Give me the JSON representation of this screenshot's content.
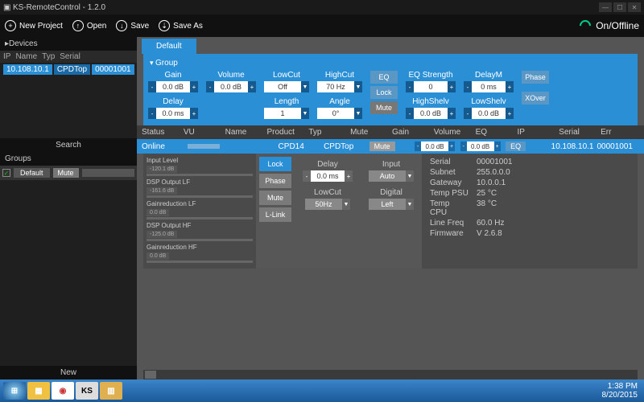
{
  "title": "KS-RemoteControl - 1.2.0",
  "toolbar": {
    "new": "New Project",
    "open": "Open",
    "save": "Save",
    "saveas": "Save As",
    "onoff": "On/Offline"
  },
  "sidebar": {
    "devices_label": "Devices",
    "cols": {
      "ip": "IP",
      "name": "Name",
      "typ": "Typ",
      "serial": "Serial"
    },
    "row": {
      "ip": "10.108.10.1",
      "name": "",
      "typ": "CPDTop",
      "serial": "00001001"
    },
    "search": "Search",
    "groups_label": "Groups",
    "group": {
      "name": "Default",
      "mute": "Mute"
    },
    "new": "New"
  },
  "tab": "Default",
  "group_head": "Group",
  "controls": {
    "gain": {
      "label": "Gain",
      "val": "0.0 dB"
    },
    "volume": {
      "label": "Volume",
      "val": "0.0 dB"
    },
    "delay": {
      "label": "Delay",
      "val": "0.0 ms"
    },
    "lowcut": {
      "label": "LowCut",
      "val": "Off"
    },
    "highcut": {
      "label": "HighCut",
      "val": "70 Hz"
    },
    "length": {
      "label": "Length",
      "val": "1"
    },
    "angle": {
      "label": "Angle",
      "val": "0°"
    },
    "eqstr": {
      "label": "EQ Strength",
      "val": "0"
    },
    "delaym": {
      "label": "DelayM",
      "val": "0 ms"
    },
    "highshelv": {
      "label": "HighShelv",
      "val": "0.0 dB"
    },
    "lowshelv": {
      "label": "LowShelv",
      "val": "0.0 dB"
    },
    "eq": "EQ",
    "lock": "Lock",
    "mute": "Mute",
    "phase": "Phase",
    "xover": "XOver"
  },
  "table": {
    "heads": {
      "status": "Status",
      "vu": "VU",
      "name": "Name",
      "product": "Product",
      "typ": "Typ",
      "mute": "Mute",
      "gain": "Gain",
      "volume": "Volume",
      "eq": "EQ",
      "ip": "IP",
      "serial": "Serial",
      "err": "Err"
    },
    "row": {
      "status": "Online",
      "name": "",
      "product": "CPD14",
      "typ": "CPDTop",
      "mute": "Mute",
      "gain": "0.0 dB",
      "volume": "0.0 dB",
      "eq": "EQ",
      "ip": "10.108.10.1",
      "serial": "00001001"
    }
  },
  "meters": {
    "m1": {
      "l": "Input Level",
      "v": "-120.1 dB"
    },
    "m2": {
      "l": "DSP Output LF",
      "v": "-161.6 dB"
    },
    "m3": {
      "l": "Gainreduction LF",
      "v": "0.0 dB"
    },
    "m4": {
      "l": "DSP Output HF",
      "v": "-125.0 dB"
    },
    "m5": {
      "l": "Gainreduction HF",
      "v": "0.0 dB"
    }
  },
  "btns": {
    "lock": "Lock",
    "phase": "Phase",
    "mute": "Mute",
    "llink": "L-Link"
  },
  "dcol": {
    "delay": {
      "label": "Delay",
      "val": "0.0 ms"
    },
    "lowcut": {
      "label": "LowCut",
      "val": "50Hz"
    },
    "input": {
      "label": "Input",
      "val": "Auto"
    },
    "digital": {
      "label": "Digital",
      "val": "Left"
    }
  },
  "info": {
    "serial": {
      "k": "Serial",
      "v": "00001001"
    },
    "subnet": {
      "k": "Subnet",
      "v": "255.0.0.0"
    },
    "gateway": {
      "k": "Gateway",
      "v": "10.0.0.1"
    },
    "tpsu": {
      "k": "Temp PSU",
      "v": "25 °C"
    },
    "tcpu": {
      "k": "Temp CPU",
      "v": "38 °C"
    },
    "freq": {
      "k": "Line Freq",
      "v": "60.0 Hz"
    },
    "fw": {
      "k": "Firmware",
      "v": "V 2.6.8"
    }
  },
  "clock": {
    "time": "1:38 PM",
    "date": "8/20/2015"
  }
}
